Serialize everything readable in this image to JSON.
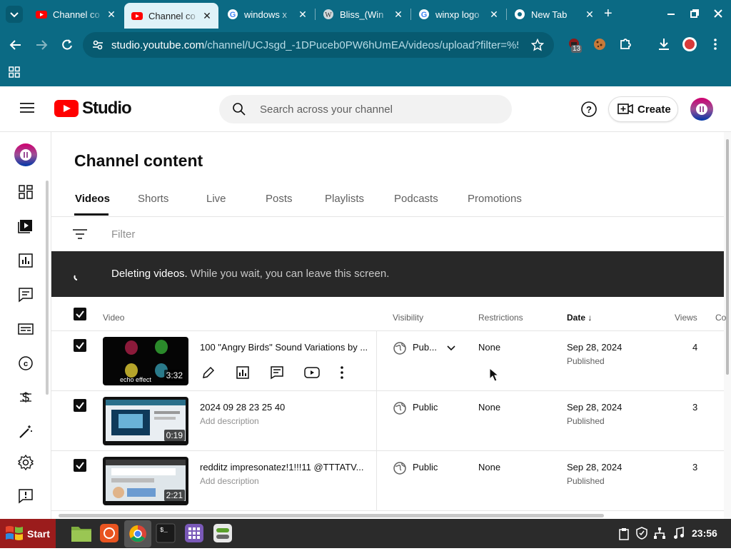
{
  "browser": {
    "tabs": [
      {
        "title": "Channel co",
        "favicon": "youtube-icon"
      },
      {
        "title": "Channel co",
        "favicon": "youtube-icon",
        "active": true
      },
      {
        "title": "windows x",
        "favicon": "google-icon"
      },
      {
        "title": "Bliss_(Win",
        "favicon": "wikipedia-icon"
      },
      {
        "title": "winxp logo",
        "favicon": "google-icon"
      },
      {
        "title": "New Tab",
        "favicon": "chrome-icon"
      }
    ],
    "url_host": "studio.youtube.com",
    "url_path": "/channel/UCJsgd_-1DPuceb0PW6hUmEA/videos/upload?filter=%5B...",
    "extension_badge": "13"
  },
  "studio": {
    "logo_text": "Studio",
    "search_placeholder": "Search across your channel",
    "create_label": "Create",
    "page_title": "Channel content",
    "tabs": [
      "Videos",
      "Shorts",
      "Live",
      "Posts",
      "Playlists",
      "Podcasts",
      "Promotions"
    ],
    "filter_placeholder": "Filter",
    "banner_bold": "Deleting videos.",
    "banner_text": "While you wait, you can leave this screen.",
    "columns": {
      "video": "Video",
      "visibility": "Visibility",
      "restrictions": "Restrictions",
      "date": "Date",
      "views": "Views",
      "comments": "Co"
    },
    "rows": [
      {
        "title": "100 \"Angry Birds\" Sound Variations by ...",
        "description": "",
        "duration": "3:32",
        "visibility": "Pub...",
        "restrictions": "None",
        "date": "Sep 28, 2024",
        "status": "Published",
        "views": "4"
      },
      {
        "title": "2024 09 28 23 25 40",
        "description": "Add description",
        "duration": "0:19",
        "visibility": "Public",
        "restrictions": "None",
        "date": "Sep 28, 2024",
        "status": "Published",
        "views": "3"
      },
      {
        "title": "redditz impresonatez!1!!!11 @TTTATV...",
        "description": "Add description",
        "duration": "2:21",
        "visibility": "Public",
        "restrictions": "None",
        "date": "Sep 28, 2024",
        "status": "Published",
        "views": "3"
      }
    ],
    "thumb1_caption": "echo effect"
  },
  "taskbar": {
    "start_label": "Start",
    "clock": "23:56"
  },
  "colors": {
    "chrome": "#0b6a84",
    "youtube_red": "#ff0000",
    "banner": "#282828",
    "start": "#9b1c1c"
  }
}
